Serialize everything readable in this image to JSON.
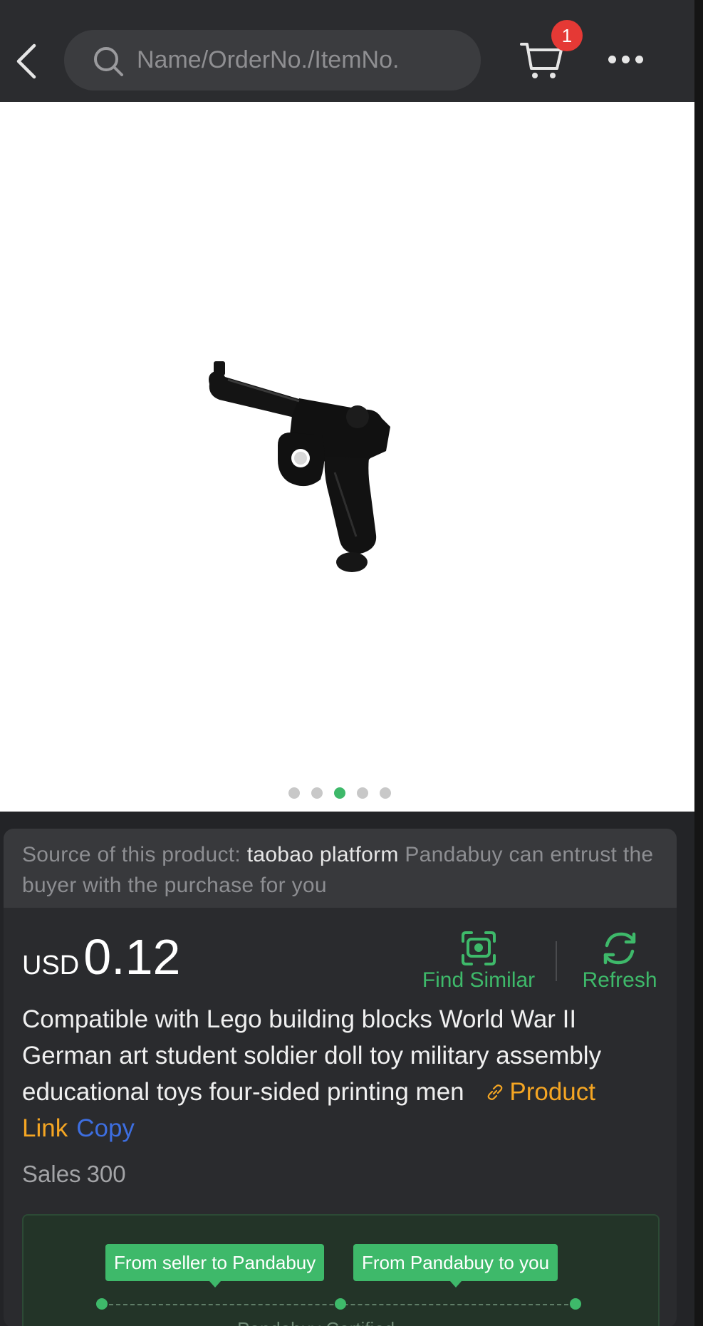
{
  "header": {
    "back_icon": "chevron-left-icon",
    "search_icon": "search-icon",
    "search_placeholder": "Name/OrderNo./ItemNo.",
    "cart_icon": "cart-icon",
    "cart_count": "1",
    "more_icon": "more-dots-icon"
  },
  "gallery": {
    "image_subject": "black toy pistol",
    "dot_count": 5,
    "active_index": 2
  },
  "product": {
    "source_prefix": "Source of this product:",
    "source_platform": "taobao platform",
    "source_suffix": "Pandabuy can entrust the buyer with the purchase for you",
    "currency": "USD",
    "price": "0.12",
    "find_similar_label": "Find Similar",
    "refresh_label": "Refresh",
    "title": "Compatible with Lego building blocks World War II German art student soldier doll toy military assembly educational toys four-sided printing men",
    "product_link_label": "Product Link",
    "copy_label": "Copy",
    "sales_label": "Sales",
    "sales_value": "300"
  },
  "shipping": {
    "step1_label": "From seller to Pandabuy",
    "step2_label": "From Pandabuy to you",
    "sub_label": "Pandabuy Certified"
  },
  "colors": {
    "accent_green": "#3eb96a",
    "badge_red": "#e53935",
    "link_orange": "#f5a623",
    "copy_blue": "#3d6ee0",
    "background": "#232427"
  }
}
